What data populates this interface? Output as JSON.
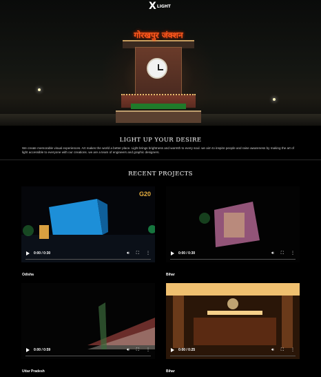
{
  "header": {
    "logo_mark": "X",
    "logo_text": "LIGHT"
  },
  "hero": {
    "sign_text": "गोरखपुर जंक्शन"
  },
  "about": {
    "title": "LIGHT UP YOUR DESIRE",
    "text": "We create memorable visual experiences. Art makes the world a better place. Light brings brightness and warmth to every soul. we aim to inspire people and raise awareness by making the art of light accessible to everyone with our creations. we are a team of engineers and graphic designers."
  },
  "projects": {
    "title": "RECENT PROJECTS",
    "badge": "G20",
    "items": [
      {
        "label": "Odisha",
        "time": "0:00 / 0:30"
      },
      {
        "label": "Bihar",
        "time": "0:00 / 0:30"
      },
      {
        "label": "Uttar Pradesh",
        "time": "0:00 / 0:59"
      },
      {
        "label": "Bihar",
        "time": "0:00 / 0:25"
      }
    ]
  },
  "icons": {
    "play": "play-icon",
    "volume": "volume-icon",
    "fullscreen": "fullscreen-icon",
    "more": "more-options-icon"
  }
}
